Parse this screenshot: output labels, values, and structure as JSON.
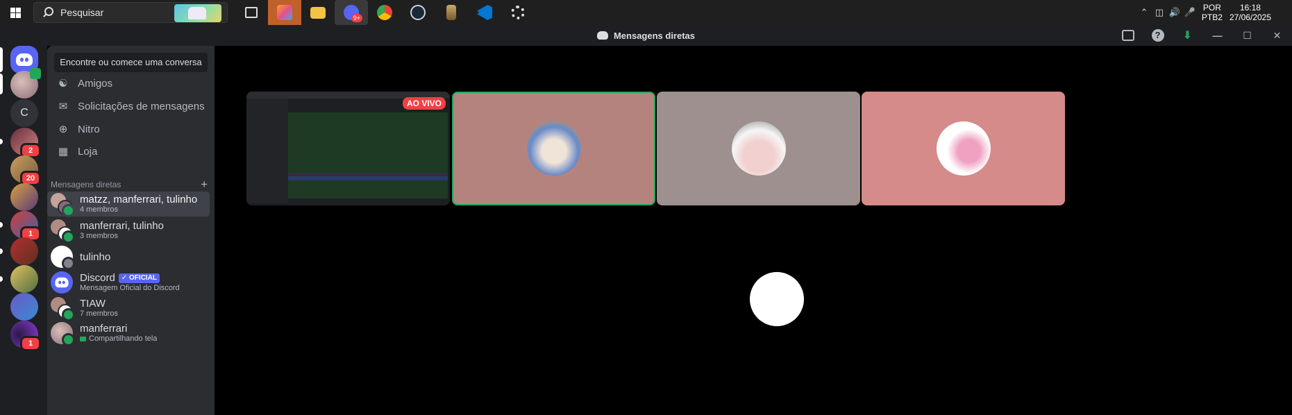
{
  "taskbar": {
    "search_placeholder": "Pesquisar",
    "discord_badge": "9+",
    "language": "POR",
    "keyboard": "PTB2",
    "time": "16:18",
    "date": "27/06/2025",
    "apps": [
      "task-view",
      "microsoft-365",
      "file-explorer",
      "discord",
      "chrome",
      "steam",
      "league-of-legends",
      "vscode",
      "settings"
    ]
  },
  "window": {
    "title": "Mensagens diretas"
  },
  "servers": [
    {
      "name": "direct-messages-home"
    },
    {
      "name": "group-avatar"
    },
    {
      "letter": "C"
    },
    {
      "badge": "2"
    },
    {
      "badge": "20"
    },
    {
      "badge": ""
    },
    {
      "badge": "1"
    },
    {
      "badge": ""
    },
    {
      "badge": ""
    },
    {
      "badge": ""
    },
    {
      "badge": "1"
    }
  ],
  "sidebar": {
    "find_button": "Encontre ou comece uma conversa",
    "nav": [
      {
        "label": "Amigos",
        "icon": "friends-icon"
      },
      {
        "label": "Solicitações de mensagens",
        "icon": "envelope-icon"
      },
      {
        "label": "Nitro",
        "icon": "nitro-icon"
      },
      {
        "label": "Loja",
        "icon": "shop-icon"
      }
    ],
    "dm_header": "Mensagens diretas",
    "dm_add": "+",
    "dms": [
      {
        "name": "matzz, manferrari, tulinho",
        "sub": "4 membros",
        "selected": true
      },
      {
        "name": "manferrari, tulinho",
        "sub": "3 membros"
      },
      {
        "name": "tulinho",
        "sub": ""
      },
      {
        "name": "Discord",
        "badge": "OFICIAL",
        "sub": "Mensagem Oficial do Discord"
      },
      {
        "name": "TIAW",
        "sub": "7 membros"
      },
      {
        "name": "manferrari",
        "sub": "Compartilhando tela"
      }
    ]
  },
  "call": {
    "live_label": "AO VIVO",
    "colors": {
      "tile_2": "#b5837e",
      "tile_3": "#9d908f",
      "tile_4": "#d48b89",
      "speaking": "#23a55a"
    }
  }
}
